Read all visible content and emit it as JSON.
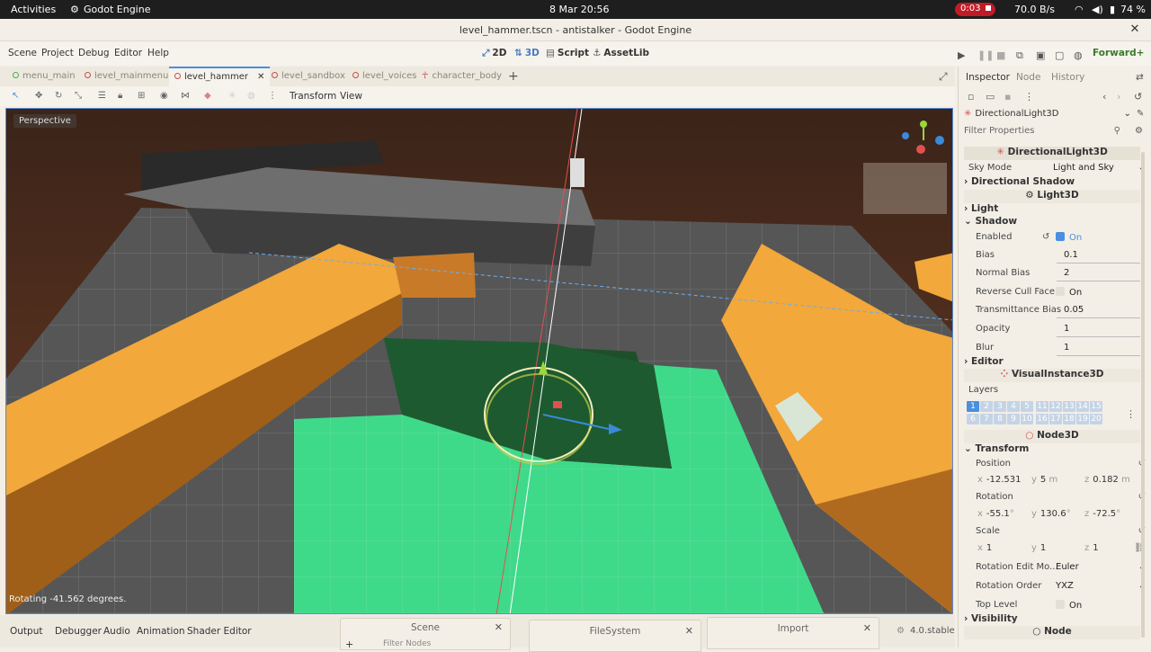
{
  "topbar": {
    "activities": "Activities",
    "app": "Godot Engine",
    "datetime": "8 Mar  20:56",
    "rec_time": "0:03",
    "net": "70.0 B/s",
    "battery": "74 %"
  },
  "window": {
    "title": "level_hammer.tscn - antistalker - Godot Engine"
  },
  "menus": [
    "Scene",
    "Project",
    "Debug",
    "Editor",
    "Help"
  ],
  "workspaces": {
    "w2d": "2D",
    "w3d": "3D",
    "script": "Script",
    "assetlib": "AssetLib"
  },
  "renderer": "Forward+",
  "scene_tabs": [
    "menu_main",
    "level_mainmenu",
    "level_hammer",
    "level_sandbox",
    "level_voices",
    "character_body"
  ],
  "viewport_toolbar": {
    "transform": "Transform",
    "view": "View"
  },
  "viewport": {
    "perspective": "Perspective",
    "status": "Rotating -41.562 degrees."
  },
  "bottom": {
    "tabs": [
      "Output",
      "Debugger",
      "Audio",
      "Animation",
      "Shader Editor"
    ],
    "version": "4.0.stable"
  },
  "docks": {
    "scene": "Scene",
    "filter_nodes": "Filter Nodes",
    "filesystem": "FileSystem",
    "import": "Import"
  },
  "inspector": {
    "tabs": [
      "Inspector",
      "Node",
      "History"
    ],
    "object": "DirectionalLight3D",
    "filter": "Filter Properties",
    "class_header": "DirectionalLight3D",
    "sky_mode": {
      "label": "Sky Mode",
      "value": "Light and Sky"
    },
    "directional_shadow": "Directional Shadow",
    "light3d": "Light3D",
    "light": "Light",
    "shadow": "Shadow",
    "enabled": {
      "label": "Enabled",
      "value": "On"
    },
    "bias": {
      "label": "Bias",
      "value": "0.1"
    },
    "normal_bias": {
      "label": "Normal Bias",
      "value": "2"
    },
    "reverse_cull": {
      "label": "Reverse Cull Face",
      "value": "On"
    },
    "transmittance": {
      "label": "Transmittance Bias",
      "value": "0.05"
    },
    "opacity": {
      "label": "Opacity",
      "value": "1"
    },
    "blur": {
      "label": "Blur",
      "value": "1"
    },
    "editor": "Editor",
    "visual_instance": "VisualInstance3D",
    "layers_label": "Layers",
    "layers_row1": [
      "1",
      "2",
      "3",
      "4",
      "5",
      "11",
      "12",
      "13",
      "14",
      "15"
    ],
    "layers_row2": [
      "6",
      "7",
      "8",
      "9",
      "10",
      "16",
      "17",
      "18",
      "19",
      "20"
    ],
    "node3d": "Node3D",
    "transform": "Transform",
    "position": {
      "label": "Position",
      "x": "-12.531",
      "y": "5",
      "y_unit": "m",
      "z": "0.182",
      "z_unit": "m"
    },
    "rotation": {
      "label": "Rotation",
      "x": "-55.1",
      "y": "130.6",
      "z": "-72.5",
      "unit": "°"
    },
    "scale": {
      "label": "Scale",
      "x": "1",
      "y": "1",
      "z": "1"
    },
    "rot_edit_mode": {
      "label": "Rotation Edit Mo...",
      "value": "Euler"
    },
    "rot_order": {
      "label": "Rotation Order",
      "value": "YXZ"
    },
    "top_level": {
      "label": "Top Level",
      "value": "On"
    },
    "visibility": "Visibility",
    "node": "Node"
  },
  "colors": {
    "accent": "#4a8fe0",
    "ground": "#3fd98a",
    "wall": "#f2a83a"
  }
}
